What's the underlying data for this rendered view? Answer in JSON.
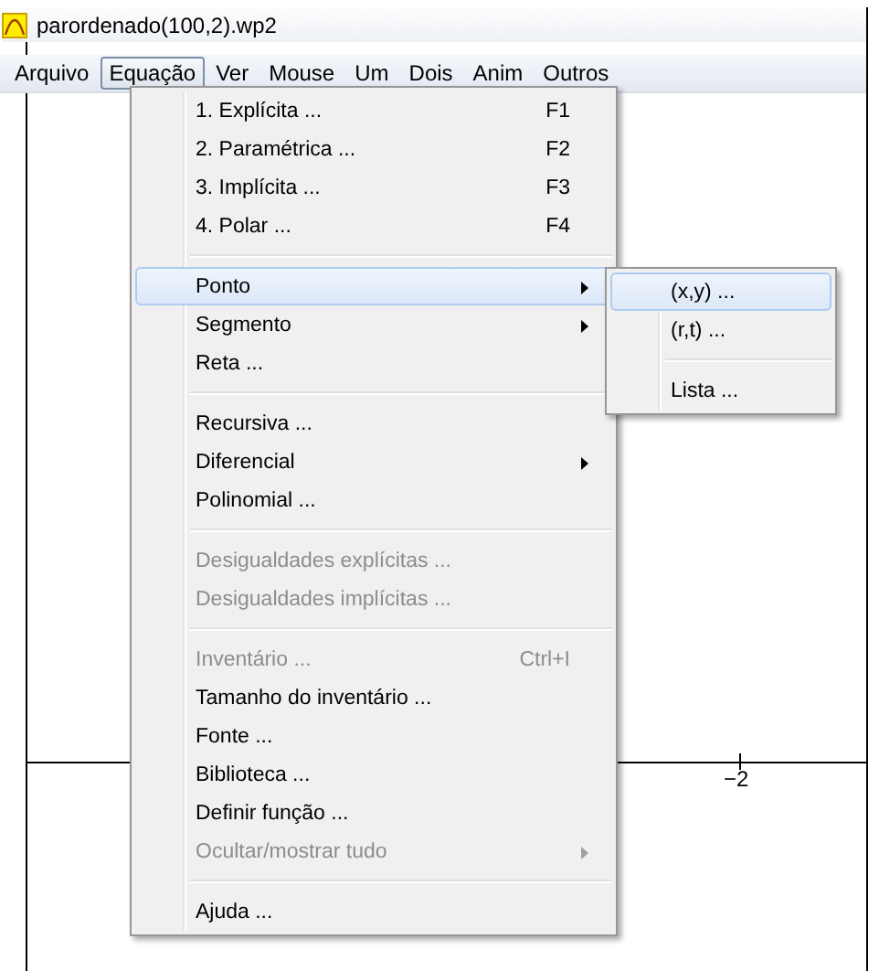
{
  "window": {
    "title": "parordenado(100,2).wp2"
  },
  "menubar": [
    {
      "label": "Arquivo",
      "selected": false
    },
    {
      "label": "Equação",
      "selected": true
    },
    {
      "label": "Ver",
      "selected": false
    },
    {
      "label": "Mouse",
      "selected": false
    },
    {
      "label": "Um",
      "selected": false
    },
    {
      "label": "Dois",
      "selected": false
    },
    {
      "label": "Anim",
      "selected": false
    },
    {
      "label": "Outros",
      "selected": false
    }
  ],
  "menu": [
    {
      "kind": "item",
      "label": "1. Explícita ...",
      "shortcut": "F1",
      "submenu": false,
      "disabled": false,
      "selected": false
    },
    {
      "kind": "item",
      "label": "2. Paramétrica ...",
      "shortcut": "F2",
      "submenu": false,
      "disabled": false,
      "selected": false
    },
    {
      "kind": "item",
      "label": "3. Implícita ...",
      "shortcut": "F3",
      "submenu": false,
      "disabled": false,
      "selected": false
    },
    {
      "kind": "item",
      "label": "4. Polar ...",
      "shortcut": "F4",
      "submenu": false,
      "disabled": false,
      "selected": false
    },
    {
      "kind": "separator"
    },
    {
      "kind": "item",
      "label": "Ponto",
      "submenu": true,
      "disabled": false,
      "selected": true
    },
    {
      "kind": "item",
      "label": "Segmento",
      "submenu": true,
      "disabled": false,
      "selected": false
    },
    {
      "kind": "item",
      "label": "Reta ...",
      "submenu": false,
      "disabled": false,
      "selected": false
    },
    {
      "kind": "separator"
    },
    {
      "kind": "item",
      "label": "Recursiva ...",
      "submenu": false,
      "disabled": false,
      "selected": false
    },
    {
      "kind": "item",
      "label": "Diferencial",
      "submenu": true,
      "disabled": false,
      "selected": false
    },
    {
      "kind": "item",
      "label": "Polinomial ...",
      "submenu": false,
      "disabled": false,
      "selected": false
    },
    {
      "kind": "separator"
    },
    {
      "kind": "item",
      "label": "Desigualdades explícitas ...",
      "submenu": false,
      "disabled": true,
      "selected": false
    },
    {
      "kind": "item",
      "label": "Desigualdades implícitas ...",
      "submenu": false,
      "disabled": true,
      "selected": false
    },
    {
      "kind": "separator"
    },
    {
      "kind": "item",
      "label": "Inventário ...",
      "shortcut": "Ctrl+I",
      "submenu": false,
      "disabled": true,
      "selected": false
    },
    {
      "kind": "item",
      "label": "Tamanho do inventário ...",
      "submenu": false,
      "disabled": false,
      "selected": false
    },
    {
      "kind": "item",
      "label": "Fonte ...",
      "submenu": false,
      "disabled": false,
      "selected": false
    },
    {
      "kind": "item",
      "label": "Biblioteca ...",
      "submenu": false,
      "disabled": false,
      "selected": false
    },
    {
      "kind": "item",
      "label": "Definir função ...",
      "submenu": false,
      "disabled": false,
      "selected": false
    },
    {
      "kind": "item",
      "label": "Ocultar/mostrar tudo",
      "submenu": true,
      "disabled": true,
      "selected": false
    },
    {
      "kind": "separator"
    },
    {
      "kind": "item",
      "label": "Ajuda ...",
      "submenu": false,
      "disabled": false,
      "selected": false
    }
  ],
  "submenu": [
    {
      "kind": "item",
      "label": "(x,y) ...",
      "selected": true
    },
    {
      "kind": "item",
      "label": "(r,t) ...",
      "selected": false
    },
    {
      "kind": "separator"
    },
    {
      "kind": "item",
      "label": "Lista ...",
      "selected": false
    }
  ],
  "axis": {
    "tick_label": "−2"
  }
}
